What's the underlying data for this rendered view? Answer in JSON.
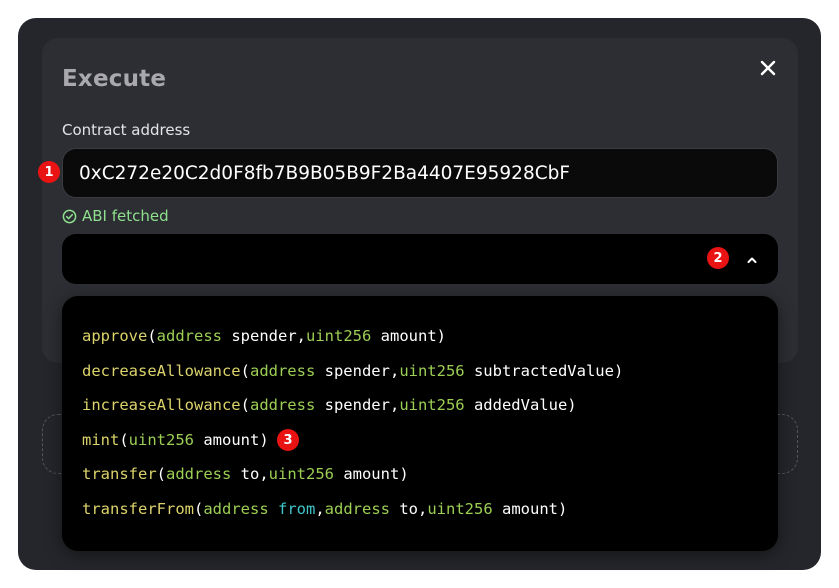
{
  "dialog": {
    "title": "Execute",
    "contract_label": "Contract address",
    "contract_address": "0xC272e20C2d0F8fb7B9B05B9F2Ba4407E95928CbF",
    "abi_status": "ABI fetched",
    "selected_function": ""
  },
  "badges": {
    "b1": "1",
    "b2": "2",
    "b3": "3"
  },
  "functions": {
    "approve": {
      "name": "approve",
      "open": "(",
      "t1": "address",
      "p1": " spender,",
      "t2": "uint256",
      "p2": " amount",
      "close": ")"
    },
    "decreaseAllowance": {
      "name": "decreaseAllowance",
      "open": "(",
      "t1": "address",
      "p1": " spender,",
      "t2": "uint256",
      "p2": " subtractedValue",
      "close": ")"
    },
    "increaseAllowance": {
      "name": "increaseAllowance",
      "open": "(",
      "t1": "address",
      "p1": " spender,",
      "t2": "uint256",
      "p2": " addedValue",
      "close": ")"
    },
    "mint": {
      "name": "mint",
      "open": "(",
      "t1": "uint256",
      "p1": " amount",
      "close": ")"
    },
    "transfer": {
      "name": "transfer",
      "open": "(",
      "t1": "address",
      "p1": " to,",
      "t2": "uint256",
      "p2": " amount",
      "close": ")"
    },
    "transferFrom": {
      "name": "transferFrom",
      "open": "(",
      "t1": "address",
      "p1": " ",
      "k1": "from",
      "sep": ",",
      "t2": "address",
      "p2": " to,",
      "t3": "uint256",
      "p3": " amount",
      "close": ")"
    }
  },
  "colors": {
    "function_name": "#dcd36a",
    "type": "#9ccf53",
    "keyword": "#3ec7c9",
    "success": "#8ee08e",
    "badge": "#ea1313"
  },
  "icons": {
    "close": "close-icon",
    "check": "check-circle-icon",
    "chevron": "chevron-up-icon"
  }
}
